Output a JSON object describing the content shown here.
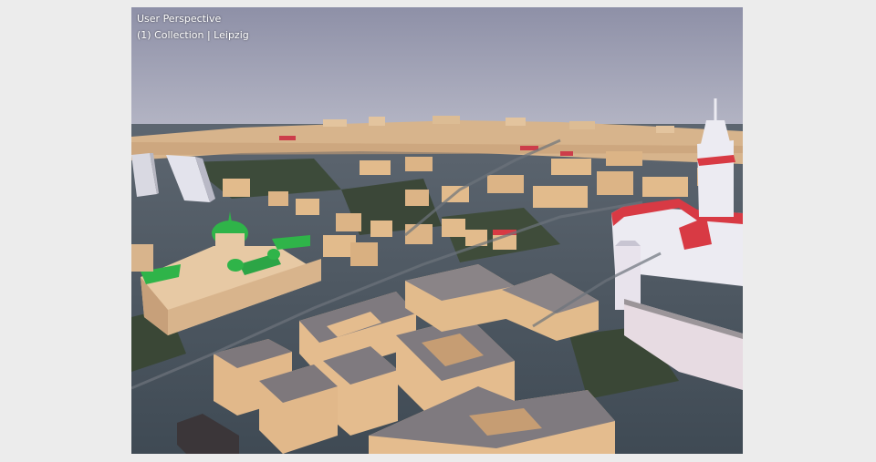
{
  "viewport": {
    "view_mode": "User Perspective",
    "collection_info": "(1) Collection | Leipzig"
  },
  "colors": {
    "page_background": "#ececec",
    "sky_top": "#8d8fa6",
    "sky_horizon": "#b9bac8",
    "ground": "#4a5560",
    "vegetation": "#3e4a34",
    "building_wall": "#e5bf90",
    "building_wall_shade": "#c99e72",
    "building_roof": "#7f7a7e",
    "accent_roof_green": "#27b04a",
    "accent_roof_red": "#d83a44",
    "tower_white": "#ecebf2"
  }
}
